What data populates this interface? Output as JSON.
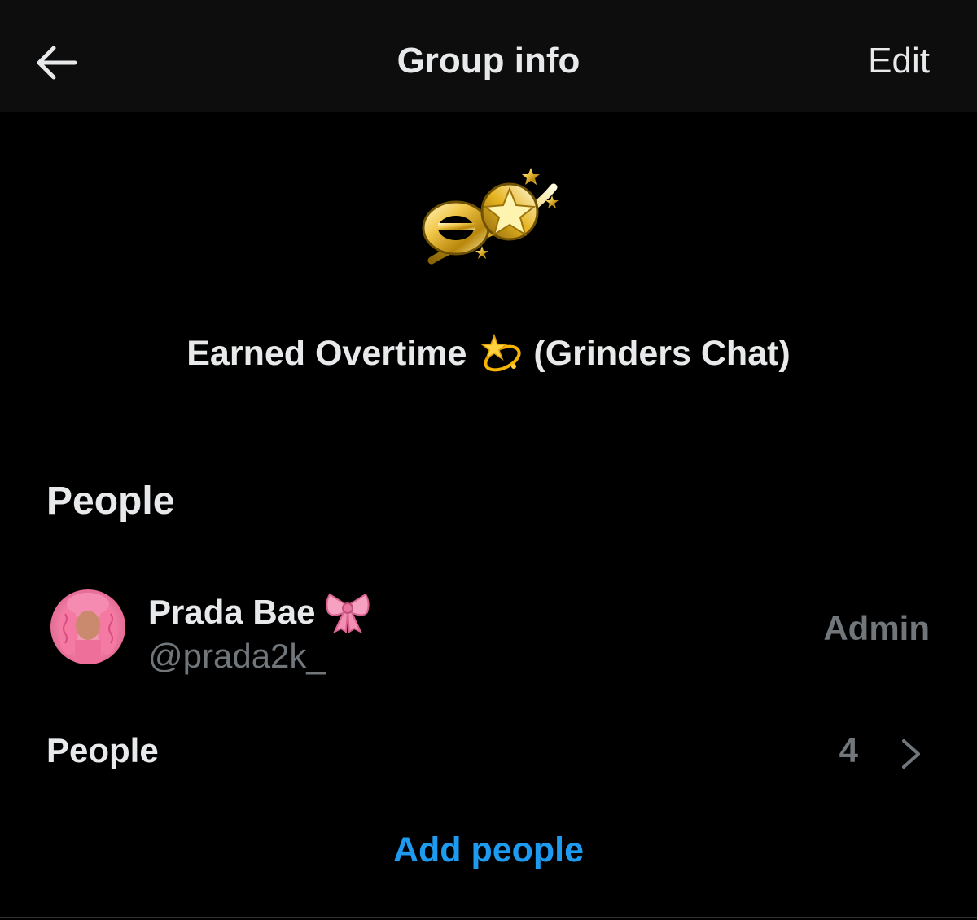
{
  "header": {
    "title": "Group info",
    "edit_label": "Edit",
    "back_icon": "arrow-left-icon"
  },
  "group": {
    "name_part1": "Earned Overtime",
    "emoji_icon": "dizzy-emoji-icon",
    "name_part2": "(Grinders Chat)",
    "avatar_icon": "gold-e-star-logo"
  },
  "people_section": {
    "title": "People",
    "members": [
      {
        "name": "Prada Bae",
        "emoji_icon": "pink-ribbon-emoji-icon",
        "handle": "@prada2k_",
        "role": "Admin"
      }
    ],
    "people_row": {
      "label": "People",
      "count": "4"
    },
    "add_people_label": "Add people"
  },
  "colors": {
    "background": "#000000",
    "header_bg": "#0d0d0d",
    "primary_text": "#e7e9ea",
    "secondary_text": "#71767b",
    "accent": "#1d9bf0",
    "divider": "#2f3336"
  }
}
